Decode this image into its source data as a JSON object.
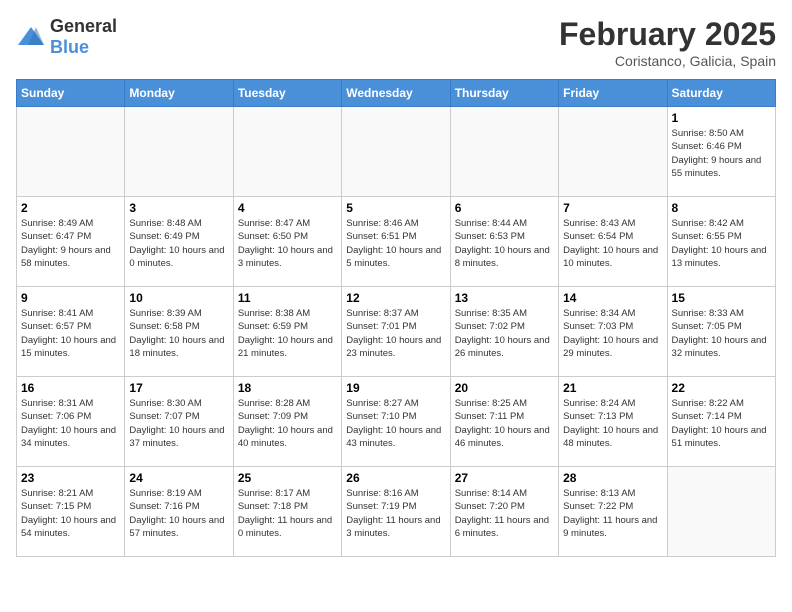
{
  "header": {
    "logo_general": "General",
    "logo_blue": "Blue",
    "month_title": "February 2025",
    "subtitle": "Coristanco, Galicia, Spain"
  },
  "days_of_week": [
    "Sunday",
    "Monday",
    "Tuesday",
    "Wednesday",
    "Thursday",
    "Friday",
    "Saturday"
  ],
  "weeks": [
    [
      {
        "day": "",
        "info": ""
      },
      {
        "day": "",
        "info": ""
      },
      {
        "day": "",
        "info": ""
      },
      {
        "day": "",
        "info": ""
      },
      {
        "day": "",
        "info": ""
      },
      {
        "day": "",
        "info": ""
      },
      {
        "day": "1",
        "info": "Sunrise: 8:50 AM\nSunset: 6:46 PM\nDaylight: 9 hours and 55 minutes."
      }
    ],
    [
      {
        "day": "2",
        "info": "Sunrise: 8:49 AM\nSunset: 6:47 PM\nDaylight: 9 hours and 58 minutes."
      },
      {
        "day": "3",
        "info": "Sunrise: 8:48 AM\nSunset: 6:49 PM\nDaylight: 10 hours and 0 minutes."
      },
      {
        "day": "4",
        "info": "Sunrise: 8:47 AM\nSunset: 6:50 PM\nDaylight: 10 hours and 3 minutes."
      },
      {
        "day": "5",
        "info": "Sunrise: 8:46 AM\nSunset: 6:51 PM\nDaylight: 10 hours and 5 minutes."
      },
      {
        "day": "6",
        "info": "Sunrise: 8:44 AM\nSunset: 6:53 PM\nDaylight: 10 hours and 8 minutes."
      },
      {
        "day": "7",
        "info": "Sunrise: 8:43 AM\nSunset: 6:54 PM\nDaylight: 10 hours and 10 minutes."
      },
      {
        "day": "8",
        "info": "Sunrise: 8:42 AM\nSunset: 6:55 PM\nDaylight: 10 hours and 13 minutes."
      }
    ],
    [
      {
        "day": "9",
        "info": "Sunrise: 8:41 AM\nSunset: 6:57 PM\nDaylight: 10 hours and 15 minutes."
      },
      {
        "day": "10",
        "info": "Sunrise: 8:39 AM\nSunset: 6:58 PM\nDaylight: 10 hours and 18 minutes."
      },
      {
        "day": "11",
        "info": "Sunrise: 8:38 AM\nSunset: 6:59 PM\nDaylight: 10 hours and 21 minutes."
      },
      {
        "day": "12",
        "info": "Sunrise: 8:37 AM\nSunset: 7:01 PM\nDaylight: 10 hours and 23 minutes."
      },
      {
        "day": "13",
        "info": "Sunrise: 8:35 AM\nSunset: 7:02 PM\nDaylight: 10 hours and 26 minutes."
      },
      {
        "day": "14",
        "info": "Sunrise: 8:34 AM\nSunset: 7:03 PM\nDaylight: 10 hours and 29 minutes."
      },
      {
        "day": "15",
        "info": "Sunrise: 8:33 AM\nSunset: 7:05 PM\nDaylight: 10 hours and 32 minutes."
      }
    ],
    [
      {
        "day": "16",
        "info": "Sunrise: 8:31 AM\nSunset: 7:06 PM\nDaylight: 10 hours and 34 minutes."
      },
      {
        "day": "17",
        "info": "Sunrise: 8:30 AM\nSunset: 7:07 PM\nDaylight: 10 hours and 37 minutes."
      },
      {
        "day": "18",
        "info": "Sunrise: 8:28 AM\nSunset: 7:09 PM\nDaylight: 10 hours and 40 minutes."
      },
      {
        "day": "19",
        "info": "Sunrise: 8:27 AM\nSunset: 7:10 PM\nDaylight: 10 hours and 43 minutes."
      },
      {
        "day": "20",
        "info": "Sunrise: 8:25 AM\nSunset: 7:11 PM\nDaylight: 10 hours and 46 minutes."
      },
      {
        "day": "21",
        "info": "Sunrise: 8:24 AM\nSunset: 7:13 PM\nDaylight: 10 hours and 48 minutes."
      },
      {
        "day": "22",
        "info": "Sunrise: 8:22 AM\nSunset: 7:14 PM\nDaylight: 10 hours and 51 minutes."
      }
    ],
    [
      {
        "day": "23",
        "info": "Sunrise: 8:21 AM\nSunset: 7:15 PM\nDaylight: 10 hours and 54 minutes."
      },
      {
        "day": "24",
        "info": "Sunrise: 8:19 AM\nSunset: 7:16 PM\nDaylight: 10 hours and 57 minutes."
      },
      {
        "day": "25",
        "info": "Sunrise: 8:17 AM\nSunset: 7:18 PM\nDaylight: 11 hours and 0 minutes."
      },
      {
        "day": "26",
        "info": "Sunrise: 8:16 AM\nSunset: 7:19 PM\nDaylight: 11 hours and 3 minutes."
      },
      {
        "day": "27",
        "info": "Sunrise: 8:14 AM\nSunset: 7:20 PM\nDaylight: 11 hours and 6 minutes."
      },
      {
        "day": "28",
        "info": "Sunrise: 8:13 AM\nSunset: 7:22 PM\nDaylight: 11 hours and 9 minutes."
      },
      {
        "day": "",
        "info": ""
      }
    ]
  ]
}
